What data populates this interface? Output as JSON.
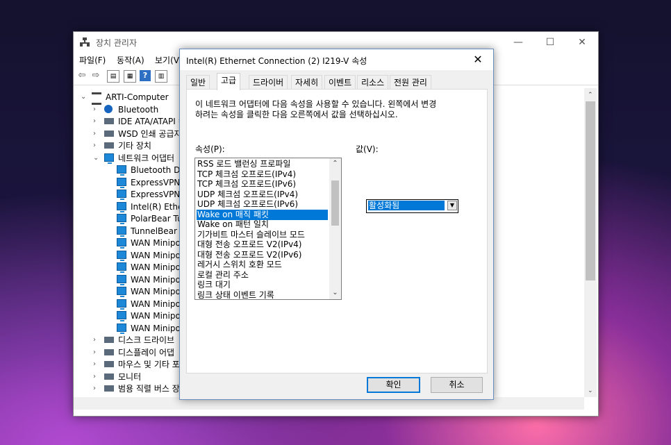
{
  "device_manager": {
    "title": "장치 관리자",
    "menu": [
      "파일(F)",
      "동작(A)",
      "보기(V)"
    ],
    "caption": {
      "minimize": "—",
      "maximize": "☐",
      "close": "✕"
    },
    "tree": [
      {
        "label": "ARTI-Computer",
        "level": 0,
        "chevron": "⌄",
        "icon": "computer-icon"
      },
      {
        "label": "Bluetooth",
        "level": 1,
        "chevron": "›",
        "icon": "bluetooth-icon"
      },
      {
        "label": "IDE ATA/ATAPI 컨",
        "level": 1,
        "chevron": "›",
        "icon": "ide-controller-icon"
      },
      {
        "label": "WSD 인쇄 공급자",
        "level": 1,
        "chevron": "›",
        "icon": "printer-icon"
      },
      {
        "label": "기타 장치",
        "level": 1,
        "chevron": "›",
        "icon": "unknown-device-icon"
      },
      {
        "label": "네트워크 어댑터",
        "level": 1,
        "chevron": "⌄",
        "icon": "network-adapter-icon"
      },
      {
        "label": "Bluetooth De",
        "level": 2,
        "icon": "network-adapter-icon"
      },
      {
        "label": "ExpressVPN T",
        "level": 2,
        "icon": "network-adapter-icon"
      },
      {
        "label": "ExpressVPN T",
        "level": 2,
        "icon": "network-adapter-icon"
      },
      {
        "label": "Intel(R) Ether",
        "level": 2,
        "icon": "network-adapter-icon"
      },
      {
        "label": "PolarBear Tur",
        "level": 2,
        "icon": "network-adapter-icon"
      },
      {
        "label": "TunnelBear A",
        "level": 2,
        "icon": "network-adapter-icon"
      },
      {
        "label": "WAN Minipo",
        "level": 2,
        "icon": "network-adapter-icon"
      },
      {
        "label": "WAN Minipo",
        "level": 2,
        "icon": "network-adapter-icon"
      },
      {
        "label": "WAN Minipo",
        "level": 2,
        "icon": "network-adapter-icon"
      },
      {
        "label": "WAN Minipo",
        "level": 2,
        "icon": "network-adapter-icon"
      },
      {
        "label": "WAN Minipo",
        "level": 2,
        "icon": "network-adapter-icon"
      },
      {
        "label": "WAN Minipo",
        "level": 2,
        "icon": "network-adapter-icon"
      },
      {
        "label": "WAN Minipo",
        "level": 2,
        "icon": "network-adapter-icon"
      },
      {
        "label": "WAN Minipo",
        "level": 2,
        "icon": "network-adapter-icon"
      },
      {
        "label": "디스크 드라이브",
        "level": 1,
        "chevron": "›",
        "icon": "disk-drive-icon"
      },
      {
        "label": "디스플레이 어댑",
        "level": 1,
        "chevron": "›",
        "icon": "display-adapter-icon"
      },
      {
        "label": "마우스 및 기타 포",
        "level": 1,
        "chevron": "›",
        "icon": "mouse-icon"
      },
      {
        "label": "모니터",
        "level": 1,
        "chevron": "›",
        "icon": "monitor-icon"
      },
      {
        "label": "범용 직렬 버스 장",
        "level": 1,
        "chevron": "›",
        "icon": "usb-icon"
      }
    ]
  },
  "dialog": {
    "title": "Intel(R) Ethernet Connection (2) I219-V 속성",
    "close": "✕",
    "tabs": [
      "일반",
      "고급",
      "드라이버",
      "자세히",
      "이벤트",
      "리소스",
      "전원 관리"
    ],
    "active_tab": "고급",
    "description": "이 네트워크 어댑터에 다음 속성을 사용할 수 있습니다. 왼쪽에서 변경\n하려는 속성을 클릭한 다음 오른쪽에서 값을 선택하십시오.",
    "property_label": "속성(P):",
    "value_label": "값(V):",
    "properties": [
      "RSS 로드 밸런싱 프로파일",
      "TCP 체크섬 오프로드(IPv4)",
      "TCP 체크섬 오프로드(IPv6)",
      "UDP 체크섬 오프로드(IPv4)",
      "UDP 체크섬 오프로드(IPv6)",
      "Wake on 매직 패킷",
      "Wake on 패턴 일치",
      "기가비트 마스터 슬레이브 모드",
      "대형 전송 오프로드 V2(IPv4)",
      "대형 전송 오프로드 V2(IPv6)",
      "레거시 스위치 호환 모드",
      "로컬 관리 주소",
      "링크 대기",
      "링크 상태 이벤트 기록"
    ],
    "selected_property": "Wake on 매직 패킷",
    "value": "활성화됨",
    "ok": "확인",
    "cancel": "취소"
  }
}
